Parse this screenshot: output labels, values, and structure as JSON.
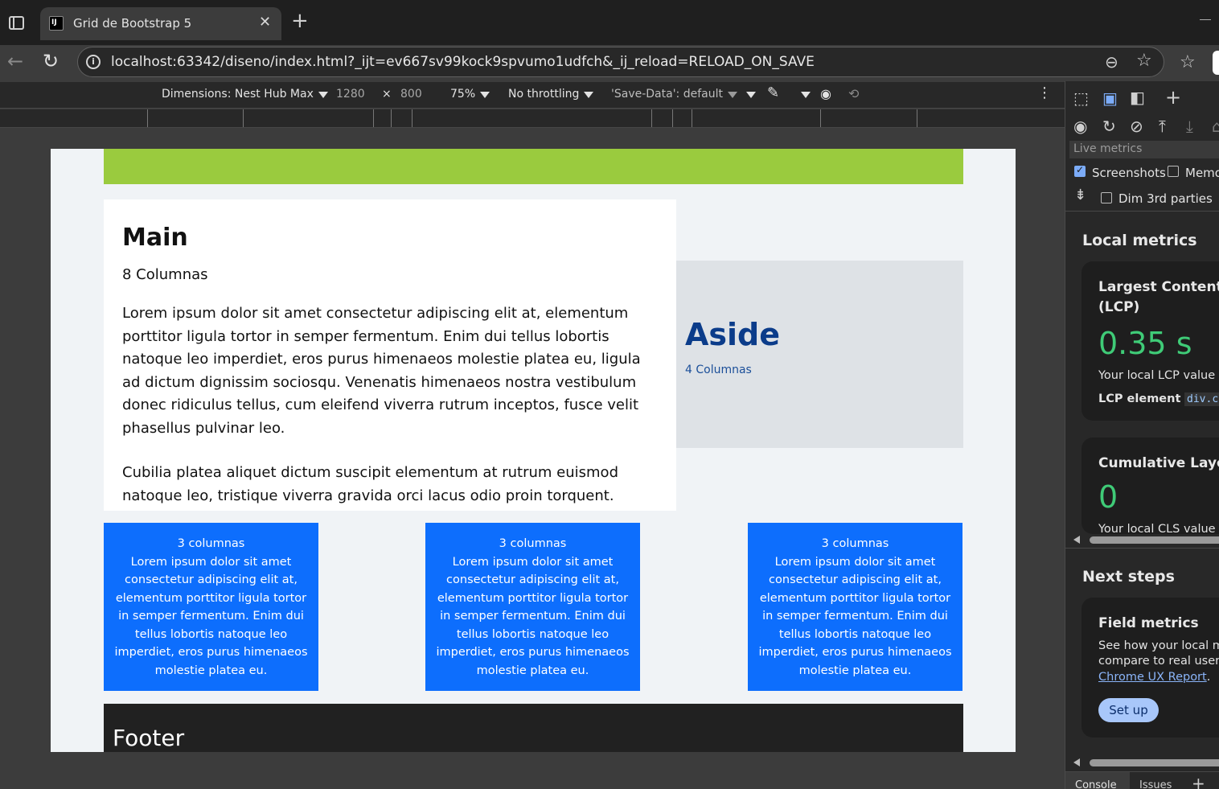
{
  "browser": {
    "tab_title": "Grid de Bootstrap 5",
    "tab_favicon": "IJ",
    "url": "localhost:63342/diseno/index.html?_ijt=ev667sv99kock9spvumo1udfch&_ij_reload=RELOAD_ON_SAVE"
  },
  "device_toolbar": {
    "dimensions_label": "Dimensions: Nest Hub Max",
    "width": "1280",
    "times": "×",
    "height": "800",
    "zoom": "75%",
    "throttling": "No throttling",
    "save_data": "'Save-Data': default"
  },
  "page": {
    "main": {
      "title": "Main",
      "subtitle": "8 Columnas",
      "paragraphs": [
        "Lorem ipsum dolor sit amet consectetur adipiscing elit at, elementum porttitor ligula tortor in semper fermentum. Enim dui tellus lobortis natoque leo imperdiet, eros purus himenaeos molestie platea eu, ligula ad dictum dignissim sociosqu. Venenatis himenaeos nostra vestibulum donec ridiculus tellus, cum eleifend viverra rutrum inceptos, fusce velit phasellus pulvinar leo.",
        "Cubilia platea aliquet dictum suscipit elementum at rutrum euismod natoque leo, tristique viverra gravida orci lacus odio proin torquent."
      ]
    },
    "aside": {
      "title": "Aside",
      "subtitle": "4 Columnas"
    },
    "columns": [
      {
        "title": "3 columnas",
        "text": "Lorem ipsum dolor sit amet consectetur adipiscing elit at, elementum porttitor ligula tortor in semper fermentum. Enim dui tellus lobortis natoque leo imperdiet, eros purus himenaeos molestie platea eu."
      },
      {
        "title": "3 columnas",
        "text": "Lorem ipsum dolor sit amet consectetur adipiscing elit at, elementum porttitor ligula tortor in semper fermentum. Enim dui tellus lobortis natoque leo imperdiet, eros purus himenaeos molestie platea eu."
      },
      {
        "title": "3 columnas",
        "text": "Lorem ipsum dolor sit amet consectetur adipiscing elit at, elementum porttitor ligula tortor in semper fermentum. Enim dui tellus lobortis natoque leo imperdiet, eros purus himenaeos molestie platea eu."
      }
    ],
    "footer": "Footer"
  },
  "devtools": {
    "live_metrics": "Live metrics",
    "screenshots_label": "Screenshots",
    "screenshots_checked": true,
    "memory_label": "Memo",
    "dim_3rd_label": "Dim 3rd parties",
    "local_metrics_heading": "Local metrics",
    "lcp_title_line1": "Largest Contentful",
    "lcp_title_line2": "(LCP)",
    "lcp_value": "0.35 s",
    "lcp_desc": "Your local LCP value of",
    "lcp_element_label": "LCP element",
    "lcp_element_code": "div.col",
    "cls_title": "Cumulative Layout",
    "cls_value": "0",
    "cls_desc": "Your local CLS value of",
    "next_steps_heading": "Next steps",
    "field_metrics_title": "Field metrics",
    "field_desc_line1": "See how your local me",
    "field_desc_line2": "compare to real user d",
    "crux_link": "Chrome UX Report",
    "crux_period": ".",
    "setup_button": "Set up",
    "drawer_console": "Console",
    "drawer_issues": "Issues"
  },
  "colors": {
    "header_green": "#9acb3e",
    "column_blue": "#0d6efd",
    "aside_bg": "#dee2e6",
    "footer_bg": "#212121",
    "metric_good": "#3fcb77"
  }
}
